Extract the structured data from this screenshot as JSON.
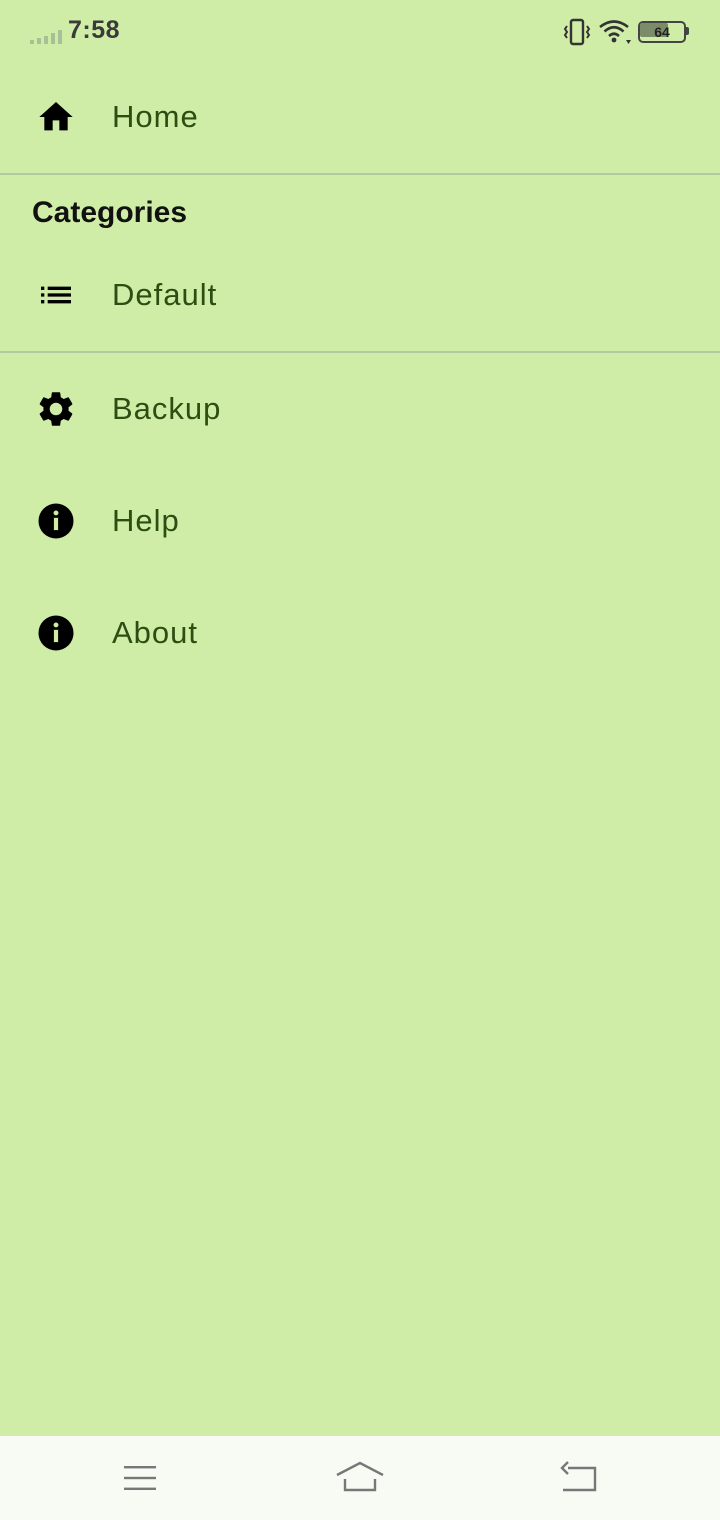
{
  "status_bar": {
    "time": "7:58",
    "battery_level": "64",
    "icons": [
      "signal-icon",
      "vibrate-icon",
      "wifi-icon",
      "battery-icon"
    ]
  },
  "drawer": {
    "home": {
      "label": "Home",
      "icon": "home-icon"
    },
    "categories_heading": "Categories",
    "categories": [
      {
        "label": "Default",
        "icon": "list-icon"
      }
    ],
    "items": [
      {
        "label": "Backup",
        "icon": "gear-icon"
      },
      {
        "label": "Help",
        "icon": "info-icon"
      },
      {
        "label": "About",
        "icon": "info-icon"
      }
    ]
  },
  "nav_bar": {
    "buttons": [
      "menu-icon",
      "home-icon",
      "back-icon"
    ]
  },
  "colors": {
    "background": "#cfeda6",
    "label_text": "#2d4e13",
    "heading_text": "#111111",
    "divider": "#b5c9a1",
    "nav_bar": "#f8faf4"
  }
}
